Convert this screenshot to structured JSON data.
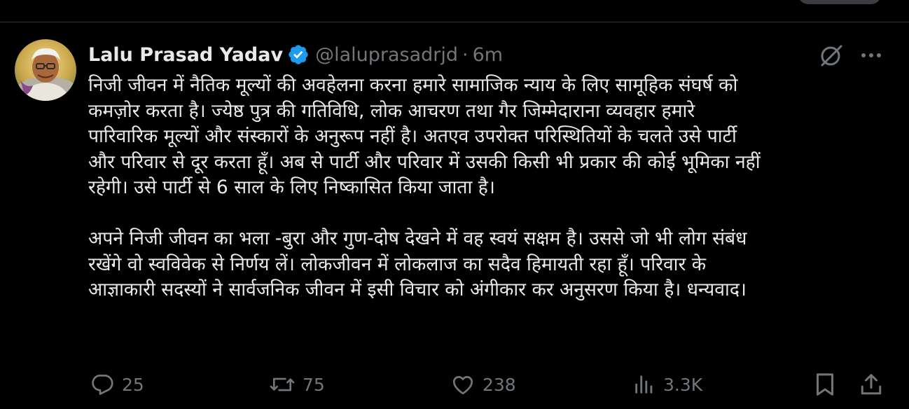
{
  "tweet": {
    "author_name": "Lalu Prasad Yadav",
    "handle": "@laluprasadrjd",
    "separator": "·",
    "time": "6m",
    "body_paragraphs": [
      [
        "निजी जीवन में नैतिक मूल्यों की अवहेलना करना हमारे सामाजिक न्याय के लिए सामूहिक संघर्ष को",
        "कमज़ोर करता है। ज्येष्ठ पुत्र की गतिविधि, लोक आचरण तथा गैर जिम्मेदाराना व्यवहार हमारे",
        "पारिवारिक मूल्यों और संस्कारों के अनुरूप नहीं है। अतएव उपरोक्त परिस्थितियों के चलते उसे पार्टी",
        "और परिवार से दूर करता हूँ। अब से पार्टी और परिवार में उसकी किसी भी प्रकार की कोई भूमिका नहीं",
        "रहेगी। उसे पार्टी से 6 साल के लिए निष्कासित किया जाता है।"
      ],
      [
        "अपने निजी जीवन का भला -बुरा और गुण-दोष देखने में वह स्वयं सक्षम है। उससे जो भी लोग संबंध",
        "रखेंगे वो स्वविवेक से निर्णय लें। लोकजीवन में लोकलाज का सदैव हिमायती रहा हूँ। परिवार के",
        "आज्ञाकारी सदस्यों ने सार्वजनिक जीवन में इसी विचार को अंगीकार कर अनुसरण किया है। धन्यवाद।"
      ]
    ]
  },
  "actions": {
    "replies": "25",
    "reposts": "75",
    "likes": "238",
    "views": "3.3K"
  },
  "icons": {
    "verified": "verified-badge-icon",
    "grok": "grok-icon",
    "more": "more-icon",
    "reply": "reply-icon",
    "repost": "repost-icon",
    "like": "like-icon",
    "views": "views-icon",
    "bookmark": "bookmark-icon",
    "share": "share-icon"
  },
  "colors": {
    "background": "#000000",
    "text_primary": "#e7e9ea",
    "text_secondary": "#71767b",
    "verified_blue": "#1d9bf0",
    "divider": "#2f3336"
  }
}
